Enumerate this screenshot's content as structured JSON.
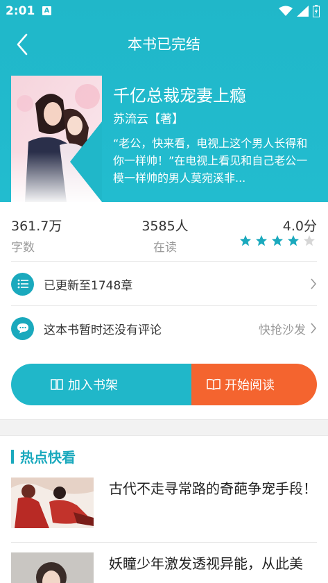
{
  "status": {
    "time": "2:01",
    "notice_badge": "A"
  },
  "topbar": {
    "title": "本书已完结"
  },
  "book": {
    "title": "千亿总裁宠妻上瘾",
    "author": "苏流云【著】",
    "description": "“老公，快来看，电视上这个男人长得和你一样帅！”在电视上看见和自己老公一模一样帅的男人莫宛溪非..."
  },
  "stats": {
    "words_value": "361.7万",
    "words_label": "字数",
    "readers_value": "3585人",
    "readers_label": "在读",
    "score_value": "4.0分",
    "rating_stars": 4,
    "rating_max": 5
  },
  "chapters": {
    "label": "已更新至1748章"
  },
  "comments": {
    "label": "这本书暂时还没有评论",
    "action": "快抢沙发"
  },
  "actions": {
    "add_shelf": "加入书架",
    "start_read": "开始阅读"
  },
  "hot": {
    "title": "热点快看",
    "items": [
      {
        "title": "古代不走寻常路的奇葩争宠手段！"
      },
      {
        "title": "妖瞳少年激发透视异能，从此美"
      }
    ]
  },
  "colors": {
    "accent": "#20b7c9",
    "orange": "#f4642f",
    "star_on": "#1aa9bd",
    "star_off": "#d6d6d6"
  }
}
